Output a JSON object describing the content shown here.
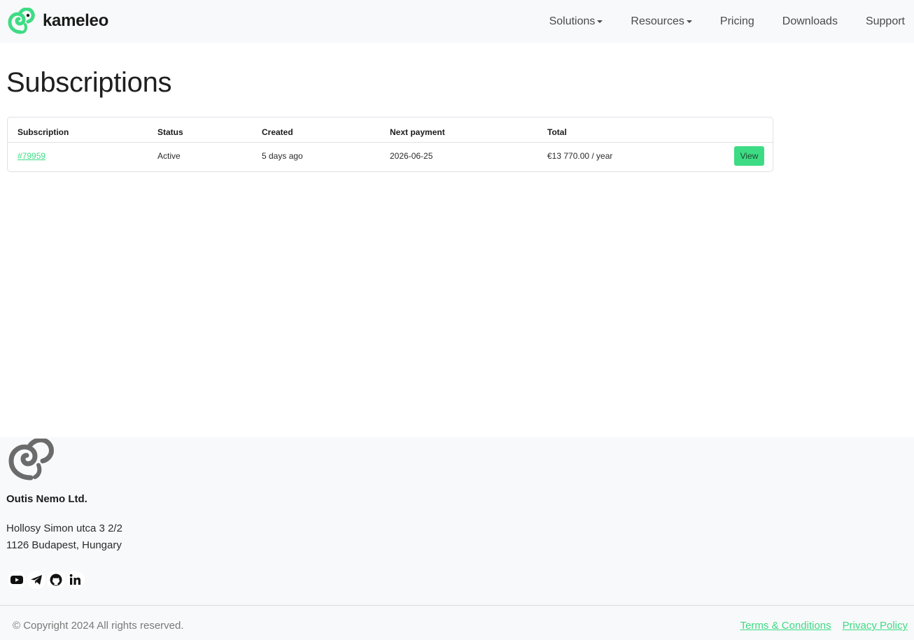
{
  "header": {
    "brand": "kameleo",
    "nav": [
      {
        "label": "Solutions",
        "dropdown": true
      },
      {
        "label": "Resources",
        "dropdown": true
      },
      {
        "label": "Pricing",
        "dropdown": false
      },
      {
        "label": "Downloads",
        "dropdown": false
      },
      {
        "label": "Support",
        "dropdown": false
      }
    ]
  },
  "main": {
    "title": "Subscriptions",
    "table": {
      "columns": [
        "Subscription",
        "Status",
        "Created",
        "Next payment",
        "Total"
      ],
      "rows": [
        {
          "subscription": "#79959",
          "status": "Active",
          "created": "5 days ago",
          "next_payment": "2026-06-25",
          "total": "€13 770.00 / year",
          "action": "View"
        }
      ]
    }
  },
  "footer": {
    "company": "Outis Nemo Ltd.",
    "address_line1": "Hollosy Simon utca 3 2/2",
    "address_line2": "1126 Budapest, Hungary",
    "socials": [
      "youtube-icon",
      "telegram-icon",
      "github-icon",
      "linkedin-icon"
    ],
    "copyright": "© Copyright 2024 All rights reserved.",
    "links": [
      "Terms & Conditions",
      "Privacy Policy"
    ]
  },
  "colors": {
    "accent": "#3ddc84",
    "header_bg": "#f8f9fa",
    "text": "#212529"
  }
}
